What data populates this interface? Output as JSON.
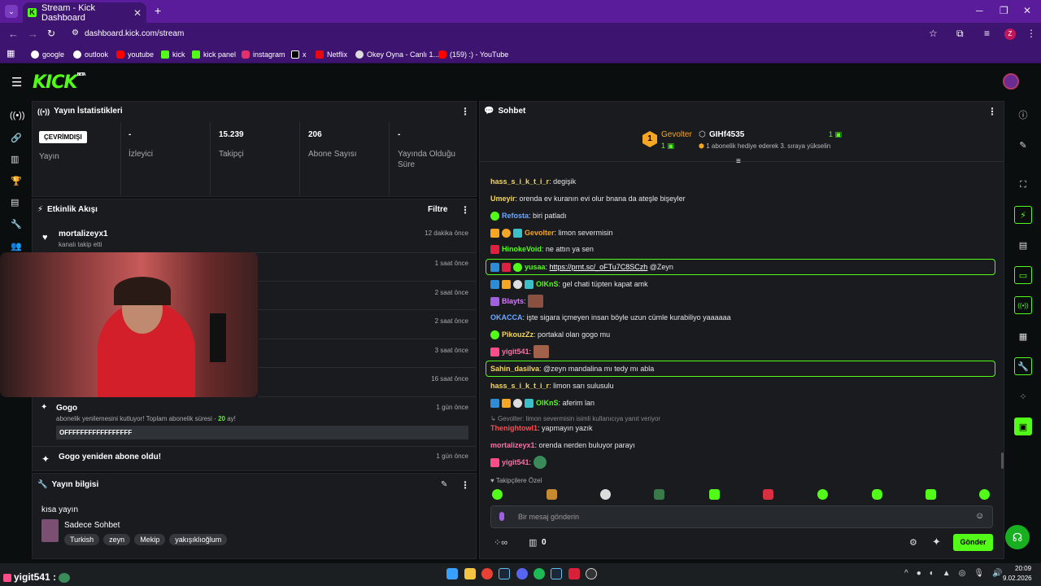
{
  "browser": {
    "tab_title": "Stream - Kick Dashboard",
    "url": "dashboard.kick.com/stream",
    "profile_initial": "Z",
    "bookmarks": [
      "google",
      "outlook",
      "youtube",
      "kick",
      "kick panel",
      "instagram",
      "x",
      "Netflix",
      "Okey Oyna - Canlı 1...",
      "(159) :) - YouTube"
    ]
  },
  "kick": {
    "logo": "KICK",
    "logo_sup": "BETA"
  },
  "stats": {
    "title": "Yayın İstatistikleri",
    "offline_badge": "ÇEVRİMDIŞI",
    "stream_label": "Yayın",
    "viewers_value": "-",
    "viewers_label": "İzleyici",
    "followers_value": "15.239",
    "followers_label": "Takipçi",
    "subs_value": "206",
    "subs_label": "Abone Sayısı",
    "uptime_value": "-",
    "uptime_label": "Yayında Olduğu Süre"
  },
  "activity": {
    "title": "Etkinlik Akışı",
    "filter": "Filtre",
    "items": [
      {
        "title": "mortalizeyx1",
        "sub": "kanalı takip etti",
        "time": "12 dakika önce"
      },
      {
        "time": "1 saat önce"
      },
      {
        "time": "2 saat önce"
      },
      {
        "time": "2 saat önce"
      },
      {
        "time": "3 saat önce"
      },
      {
        "time": "16 saat önce"
      },
      {
        "title": "Gogo",
        "sub_prefix": "abonelik yenilemesini kutluyor! Toplam abonelik süresi - ",
        "sub_num": "20",
        "sub_suffix": " ay!",
        "message": "OFFFFFFFFFFFFFFFFF",
        "time": "1 gün önce"
      },
      {
        "title": "Gogo yeniden abone oldu!",
        "time": "1 gün önce"
      }
    ]
  },
  "info": {
    "title": "Yayın bilgisi",
    "stream_title": "kısa yayın",
    "category": "Sadece Sohbet",
    "tags": [
      "Turkish",
      "zeyn",
      "Mekip",
      "yakışıklıoğlum"
    ]
  },
  "chat": {
    "title": "Sohbet",
    "leaderboard": {
      "first_name": "Gevolter",
      "first_count": "1",
      "gift_name": "GIHf4535",
      "gift_count": "1",
      "gift_text": "1 abonelik hediye ederek 3. sıraya yükselin"
    },
    "messages": [
      {
        "user": "hass_s_i_k_t_i_r",
        "color": "#f5d75d",
        "text": "degişik"
      },
      {
        "user": "Umeyir",
        "color": "#f5d75d",
        "text": "orenda ev kuranın evi olur bnana da ateşle bişeyler"
      },
      {
        "user": "Refosta",
        "color": "#6fa8ff",
        "text": "biri patladı"
      },
      {
        "user": "Gevolter",
        "color": "#f5a623",
        "text": "limon severmisin"
      },
      {
        "user": "HinokeVoid",
        "color": "#53fc18",
        "text": "ne attın ya sen"
      },
      {
        "user": "yusaa",
        "color": "#53fc18",
        "text": "@Zeyn",
        "link": "https://prnt.sc/_oFTu7C8SCzh"
      },
      {
        "user": "OlKnS",
        "color": "#53fc18",
        "text": "gel chati tüpten kapat amk"
      },
      {
        "user": "Blayts",
        "color": "#d97bff",
        "text": ""
      },
      {
        "user": "OKACCA",
        "color": "#6fa8ff",
        "text": "işte sigara içmeyen insan böyle uzun cümle kurabiliyo yaaaaaa"
      },
      {
        "user": "PikouzZz",
        "color": "#f5d75d",
        "text": "portakal olan gogo mu"
      },
      {
        "user": "yigit541",
        "color": "#ff6fa8",
        "text": ""
      },
      {
        "user": "Sahin_dasilva",
        "color": "#f5d75d",
        "text": "@zeyn mandalina mı tedy mı abla"
      },
      {
        "user": "hass_s_i_k_t_i_r",
        "color": "#f5d75d",
        "text": "limon sarı sulusulu"
      },
      {
        "user": "OlKnS",
        "color": "#53fc18",
        "text": "aferim lan"
      },
      {
        "reply": "Gevolter: limon severmisin isimli kullanıcıya yanıt veriyor"
      },
      {
        "user": "Thenightowl1",
        "color": "#ff4d4d",
        "text": "yapmayın yazık"
      },
      {
        "user": "mortalizeyx1",
        "color": "#ff6fa8",
        "text": "orenda nerden buluyor parayı"
      },
      {
        "user": "yigit541",
        "color": "#ff6fa8",
        "text": ""
      }
    ],
    "followers_only": "Takipçilere Özel",
    "input_placeholder": "Bir mesaj gönderin",
    "points": "0",
    "send": "Gönder"
  },
  "overlay": {
    "user": "yigit541",
    "sep": ":"
  },
  "taskbar": {
    "time": "20:09",
    "date": "9.02.2026"
  }
}
